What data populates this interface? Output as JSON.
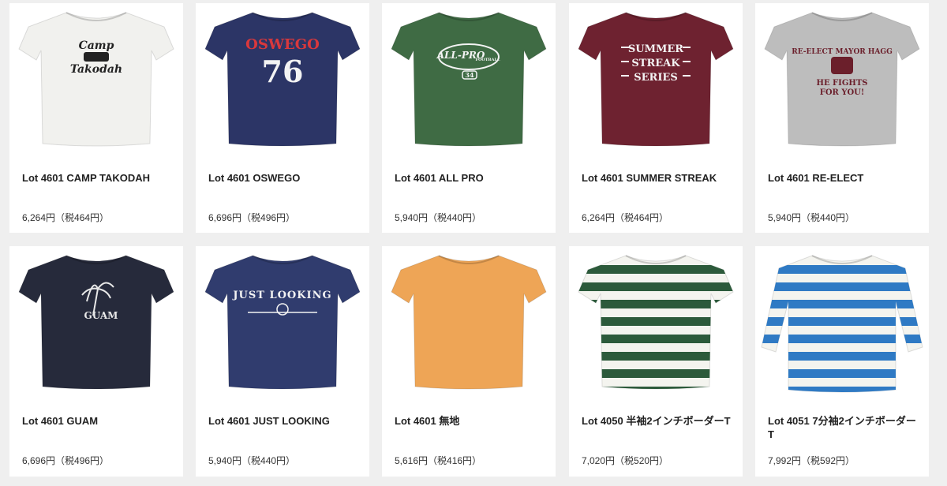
{
  "products": [
    {
      "title": "Lot 4601 CAMP TAKODAH",
      "price": "6,264円（税464円）",
      "shirt_color": "#f1f1ee",
      "graphic": [
        "Camp",
        "Takodah"
      ],
      "graphic_color": "#222222",
      "style": "tee",
      "icon": "tshirt-camp-takodah"
    },
    {
      "title": "Lot 4601 OSWEGO",
      "price": "6,696円（税496円）",
      "shirt_color": "#2c3566",
      "graphic": [
        "OSWEGO",
        "76"
      ],
      "graphic_color": "#d9383c",
      "graphic_color2": "#f3f3f3",
      "style": "tee",
      "icon": "tshirt-oswego"
    },
    {
      "title": "Lot 4601 ALL PRO",
      "price": "5,940円（税440円）",
      "shirt_color": "#3f6b44",
      "graphic": [
        "ALL-PRO",
        "FOOTBALL",
        "34"
      ],
      "graphic_color": "#f3f3f3",
      "style": "tee",
      "icon": "tshirt-all-pro"
    },
    {
      "title": "Lot 4601 SUMMER STREAK",
      "price": "6,264円（税464円）",
      "shirt_color": "#6e2230",
      "graphic": [
        "SUMMER",
        "STREAK",
        "SERIES"
      ],
      "graphic_color": "#f3f3f3",
      "style": "tee",
      "icon": "tshirt-summer-streak"
    },
    {
      "title": "Lot 4601 RE-ELECT",
      "price": "5,940円（税440円）",
      "shirt_color": "#bdbdbd",
      "graphic": [
        "RE-ELECT MAYOR HAGG",
        "HE FIGHTS",
        "FOR YOU!"
      ],
      "graphic_color": "#6b1f2b",
      "style": "tee",
      "icon": "tshirt-re-elect"
    },
    {
      "title": "Lot 4601 GUAM",
      "price": "6,696円（税496円）",
      "shirt_color": "#262a3b",
      "graphic": [
        "GUAM"
      ],
      "graphic_color": "#e8e8e8",
      "style": "tee",
      "icon": "tshirt-guam"
    },
    {
      "title": "Lot 4601 JUST LOOKING",
      "price": "5,940円（税440円）",
      "shirt_color": "#303c6e",
      "graphic": [
        "JUST LOOKING"
      ],
      "graphic_color": "#f3f3f3",
      "style": "tee",
      "icon": "tshirt-just-looking"
    },
    {
      "title": "Lot 4601 無地",
      "price": "5,616円（税416円）",
      "shirt_color": "#eea556",
      "graphic": [],
      "graphic_color": "#eea556",
      "style": "tee",
      "icon": "tshirt-plain"
    },
    {
      "title": "Lot 4050 半袖2インチボーダーT",
      "price": "7,020円（税520円）",
      "shirt_color": "#f4f4ef",
      "stripe_color": "#2c5a3b",
      "graphic": [],
      "graphic_color": "#2c5a3b",
      "style": "stripe-short",
      "icon": "tshirt-stripe-green"
    },
    {
      "title": "Lot 4051 7分袖2インチボーダーT",
      "price": "7,992円（税592円）",
      "shirt_color": "#f4f4ef",
      "stripe_color": "#2f7ac4",
      "graphic": [],
      "graphic_color": "#2f7ac4",
      "style": "stripe-long",
      "icon": "tshirt-stripe-blue"
    }
  ]
}
